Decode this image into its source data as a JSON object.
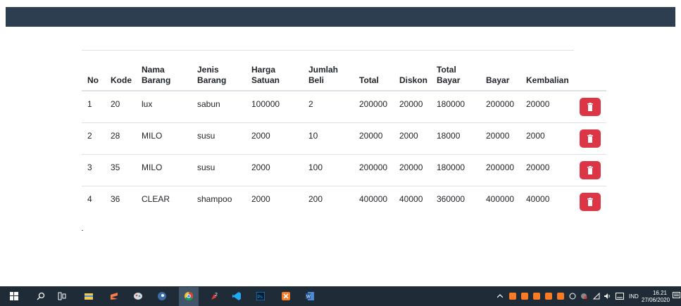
{
  "colors": {
    "navbar": "#2c3e50",
    "danger": "#dc3545",
    "taskbar": "#1f2b36"
  },
  "table": {
    "headers": [
      [
        "No"
      ],
      [
        "Kode"
      ],
      [
        "Nama",
        "Barang"
      ],
      [
        "Jenis",
        "Barang"
      ],
      [
        "Harga",
        "Satuan"
      ],
      [
        "Jumlah",
        "Beli"
      ],
      [
        "Total"
      ],
      [
        "Diskon"
      ],
      [
        "Total",
        "Bayar"
      ],
      [
        "Bayar"
      ],
      [
        "Kembalian"
      ],
      [
        ""
      ]
    ],
    "rows": [
      [
        "1",
        "20",
        "lux",
        "sabun",
        "100000",
        "2",
        "200000",
        "20000",
        "180000",
        "200000",
        "20000"
      ],
      [
        "2",
        "28",
        "MILO",
        "susu",
        "2000",
        "10",
        "20000",
        "2000",
        "18000",
        "20000",
        "2000"
      ],
      [
        "3",
        "35",
        "MILO",
        "susu",
        "2000",
        "100",
        "200000",
        "20000",
        "180000",
        "200000",
        "20000"
      ],
      [
        "4",
        "36",
        "CLEAR",
        "shampoo",
        "2000",
        "200",
        "400000",
        "40000",
        "360000",
        "400000",
        "40000"
      ]
    ],
    "delete_icon": "trash-icon"
  },
  "taskbar": {
    "apps": [
      "windows-start-icon",
      "search-icon",
      "task-view-icon",
      "file-explorer-icon",
      "sublime-text-icon",
      "paint-icon",
      "steam-icon",
      "chrome-icon",
      "app-icon",
      "vscode-icon",
      "photoshop-icon",
      "xampp-icon",
      "word-icon"
    ],
    "tray": {
      "language": "IND",
      "time": "16.21",
      "date": "27/06/2020"
    }
  }
}
